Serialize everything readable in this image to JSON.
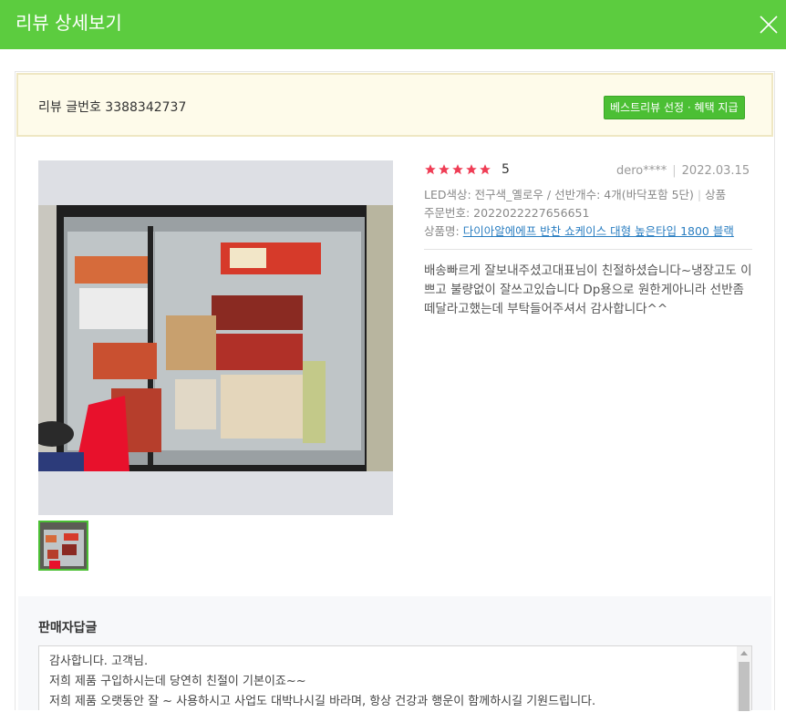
{
  "modal": {
    "title": "리뷰 상세보기",
    "close_icon": "close-icon"
  },
  "review": {
    "number_label": "리뷰 글번호 3388342737",
    "best_button": "베스트리뷰 선정 · 혜택 지급",
    "rating": 5,
    "rating_text": "5",
    "author": "dero****",
    "date": "2022.03.15",
    "option": "LED색상: 전구색_옐로우 / 선반개수: 4개(바닥포함 5단)",
    "option_extra": "상품",
    "order_number": "주문번호: 2022022227656651",
    "product_label": "상품명:",
    "product_name": "다이아알에에프 반찬 쇼케이스 대형 높은타입 1800 블랙",
    "content": "배송빠르게 잘보내주셨고대표님이 친절하셨습니다~냉장고도 이쁘고 불량없이 잘쓰고있습니다 Dp용으로 원한게아니라 선반좀 떼달라고했는데 부탁들어주셔서 감사합니다^^"
  },
  "reply": {
    "title": "판매자답글",
    "lines": [
      "감사합니다. 고객님.",
      "저희 제품 구입하시는데 당연히 친절이 기본이죠~~",
      "저희 제품 오랫동안 잘 ~ 사용하시고 사업도 대박나시길 바라며, 항상 건강과 행운이 함께하시길 기원드립니다."
    ]
  },
  "colors": {
    "header": "#5ccc3f",
    "accent": "#4bbf34",
    "star": "#ef3c54",
    "link": "#2a7ec1"
  }
}
